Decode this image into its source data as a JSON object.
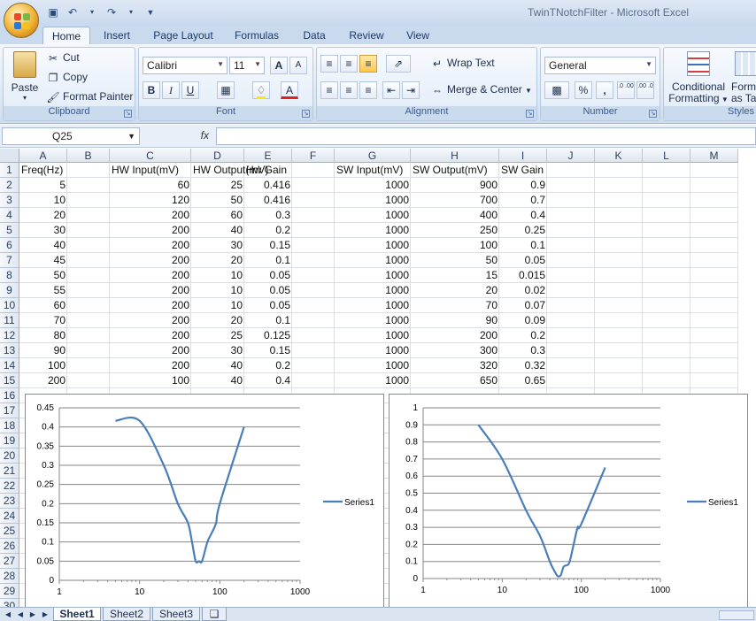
{
  "window": {
    "title": "TwinTNotchFilter - Microsoft Excel"
  },
  "colors": {
    "series": "#4a7ebb"
  },
  "ribbon": {
    "tabs": [
      "Home",
      "Insert",
      "Page Layout",
      "Formulas",
      "Data",
      "Review",
      "View"
    ],
    "active_tab": "Home",
    "clipboard": {
      "paste": "Paste",
      "cut": "Cut",
      "copy": "Copy",
      "format_painter": "Format Painter",
      "label": "Clipboard"
    },
    "font": {
      "name": "Calibri",
      "size": "11",
      "label": "Font",
      "bold": "B",
      "italic": "I",
      "underline": "U",
      "grow": "A",
      "shrink": "A",
      "color": "A"
    },
    "alignment": {
      "wrap_text": "Wrap Text",
      "merge_center": "Merge & Center",
      "label": "Alignment"
    },
    "number": {
      "format": "General",
      "label": "Number",
      "percent": "%",
      "comma": ",",
      "inc_decimal": ".0 .00",
      "dec_decimal": ".00 .0"
    },
    "styles": {
      "conditional_formatting": "Conditional",
      "conditional_formatting_2": "Formatting",
      "format_as_table": "Form",
      "format_as_table_2": "as Tab",
      "label": "Styles"
    }
  },
  "formula_bar": {
    "name_box": "Q25",
    "fx": "fx",
    "value": ""
  },
  "sheet": {
    "columns": [
      "A",
      "B",
      "C",
      "D",
      "E",
      "F",
      "G",
      "H",
      "I",
      "J",
      "K",
      "L",
      "M"
    ],
    "rows": [
      "1",
      "2",
      "3",
      "4",
      "5",
      "6",
      "7",
      "8",
      "9",
      "10",
      "11",
      "12",
      "13",
      "14",
      "15",
      "16",
      "17",
      "18",
      "19",
      "20",
      "21",
      "22",
      "23",
      "24",
      "25",
      "26",
      "27",
      "28",
      "29",
      "30"
    ],
    "headers": {
      "A": "Freq(Hz)",
      "C": "HW Input(mV)",
      "D": "HW Output(mV)",
      "E": "Hw Gain",
      "G": "SW Input(mV)",
      "H": "SW Output(mV)",
      "I": "SW Gain"
    },
    "data": [
      [
        "5",
        "60",
        "25",
        "0.416",
        "1000",
        "900",
        "0.9"
      ],
      [
        "10",
        "120",
        "50",
        "0.416",
        "1000",
        "700",
        "0.7"
      ],
      [
        "20",
        "200",
        "60",
        "0.3",
        "1000",
        "400",
        "0.4"
      ],
      [
        "30",
        "200",
        "40",
        "0.2",
        "1000",
        "250",
        "0.25"
      ],
      [
        "40",
        "200",
        "30",
        "0.15",
        "1000",
        "100",
        "0.1"
      ],
      [
        "45",
        "200",
        "20",
        "0.1",
        "1000",
        "50",
        "0.05"
      ],
      [
        "50",
        "200",
        "10",
        "0.05",
        "1000",
        "15",
        "0.015"
      ],
      [
        "55",
        "200",
        "10",
        "0.05",
        "1000",
        "20",
        "0.02"
      ],
      [
        "60",
        "200",
        "10",
        "0.05",
        "1000",
        "70",
        "0.07"
      ],
      [
        "70",
        "200",
        "20",
        "0.1",
        "1000",
        "90",
        "0.09"
      ],
      [
        "80",
        "200",
        "25",
        "0.125",
        "1000",
        "200",
        "0.2"
      ],
      [
        "90",
        "200",
        "30",
        "0.15",
        "1000",
        "300",
        "0.3"
      ],
      [
        "100",
        "200",
        "40",
        "0.2",
        "1000",
        "320",
        "0.32"
      ],
      [
        "200",
        "100",
        "40",
        "0.4",
        "1000",
        "650",
        "0.65"
      ]
    ],
    "tabs": [
      "Sheet1",
      "Sheet2",
      "Sheet3"
    ],
    "active_tab": "Sheet1"
  },
  "chart_data": [
    {
      "type": "line",
      "x": [
        5,
        10,
        20,
        30,
        40,
        45,
        50,
        55,
        60,
        70,
        80,
        90,
        100,
        200
      ],
      "series": [
        {
          "name": "Series1",
          "values": [
            0.416,
            0.416,
            0.3,
            0.2,
            0.15,
            0.1,
            0.05,
            0.05,
            0.05,
            0.1,
            0.125,
            0.15,
            0.2,
            0.4
          ]
        }
      ],
      "xscale": "log",
      "xlim": [
        1,
        1000
      ],
      "xticks": [
        "1",
        "10",
        "100",
        "1000"
      ],
      "ylim": [
        0,
        0.45
      ],
      "yticks": [
        "0",
        "0.05",
        "0.1",
        "0.15",
        "0.2",
        "0.25",
        "0.3",
        "0.35",
        "0.4",
        "0.45"
      ],
      "grid": "horizontal",
      "legend": "right"
    },
    {
      "type": "line",
      "x": [
        5,
        10,
        20,
        30,
        40,
        45,
        50,
        55,
        60,
        70,
        80,
        90,
        100,
        200
      ],
      "series": [
        {
          "name": "Series1",
          "values": [
            0.9,
            0.7,
            0.4,
            0.25,
            0.1,
            0.05,
            0.015,
            0.02,
            0.07,
            0.09,
            0.2,
            0.3,
            0.32,
            0.65
          ]
        }
      ],
      "xscale": "log",
      "xlim": [
        1,
        1000
      ],
      "xticks": [
        "1",
        "10",
        "100",
        "1000"
      ],
      "ylim": [
        0,
        1
      ],
      "yticks": [
        "0",
        "0.1",
        "0.2",
        "0.3",
        "0.4",
        "0.5",
        "0.6",
        "0.7",
        "0.8",
        "0.9",
        "1"
      ],
      "grid": "horizontal",
      "legend": "right"
    }
  ]
}
